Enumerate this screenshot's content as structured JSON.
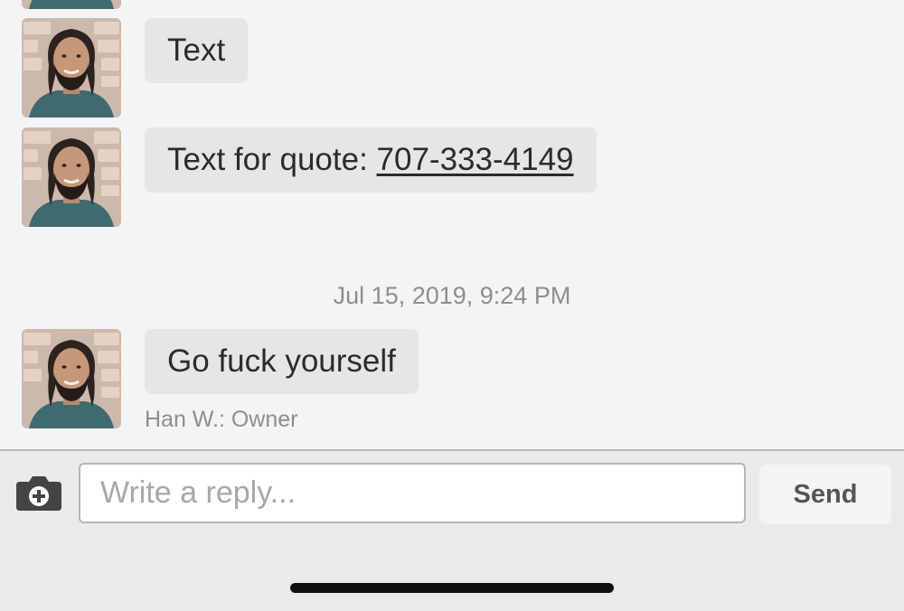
{
  "messages": [
    {
      "text": "Text",
      "sender_avatar": "avatar-han"
    },
    {
      "text_prefix": "Text for quote: ",
      "phone": "707-333-4149",
      "sender_avatar": "avatar-han"
    },
    {
      "text": "Go fuck yourself",
      "sender_avatar": "avatar-han"
    }
  ],
  "timestamp": "Jul 15, 2019, 9:24 PM",
  "sender_meta": "Han W.: Owner",
  "composer": {
    "placeholder": "Write a reply...",
    "send_label": "Send",
    "camera_icon": "camera-add-icon"
  },
  "colors": {
    "background": "#f4f4f4",
    "bubble": "#e6e6e6",
    "composer_bg": "#eaeaea",
    "meta_text": "#8e8e8e"
  }
}
